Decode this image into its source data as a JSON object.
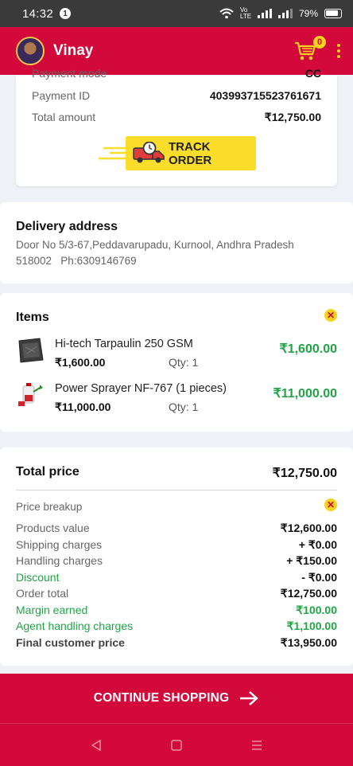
{
  "status_bar": {
    "time": "14:32",
    "notification_count": "1",
    "network": "Vo LTE",
    "battery": "79%"
  },
  "header": {
    "user_name": "Vinay",
    "cart_count": "0"
  },
  "payment": {
    "mode_label": "Payment mode",
    "mode_value": "CC",
    "id_label": "Payment ID",
    "id_value": "403993715523761671",
    "amount_label": "Total amount",
    "amount_value": "₹12,750.00",
    "track_label": "TRACK ORDER"
  },
  "delivery": {
    "title": "Delivery address",
    "address_line": "Door No 5/3-67,Peddavarupadu, Kurnool, Andhra Pradesh",
    "pin_phone": "518002   Ph:6309146769"
  },
  "items": {
    "title": "Items",
    "list": [
      {
        "name": "Hi-tech Tarpaulin 250 GSM",
        "price": "₹1,600.00",
        "qty": "Qty:  1",
        "total": "₹1,600.00"
      },
      {
        "name": "Power Sprayer NF-767 (1 pieces)",
        "price": "₹11,000.00",
        "qty": "Qty:  1",
        "total": "₹11,000.00"
      }
    ]
  },
  "summary": {
    "total_label": "Total price",
    "total_value": "₹12,750.00",
    "breakup_label": "Price breakup",
    "rows": [
      {
        "label": "Products value",
        "value": "₹12,600.00"
      },
      {
        "label": "Shipping charges",
        "value": "+ ₹0.00"
      },
      {
        "label": "Handling charges",
        "value": "+ ₹150.00"
      },
      {
        "label": "Discount",
        "value": "- ₹0.00"
      },
      {
        "label": "Order total",
        "value": "₹12,750.00"
      },
      {
        "label": "Margin earned",
        "value": "₹100.00"
      },
      {
        "label": "Agent handling charges",
        "value": "₹1,100.00"
      },
      {
        "label": "Final customer price",
        "value": "₹13,950.00"
      }
    ]
  },
  "cta": {
    "label": "CONTINUE SHOPPING"
  },
  "colors": {
    "brand_red": "#d2093a",
    "accent_yellow": "#fbdd2a",
    "positive_green": "#22a447"
  },
  "icons": [
    "avatar",
    "cart-icon",
    "kebab-menu-icon",
    "truck-icon",
    "close-icon",
    "arrow-right-icon",
    "back-icon",
    "home-icon",
    "recents-icon"
  ]
}
